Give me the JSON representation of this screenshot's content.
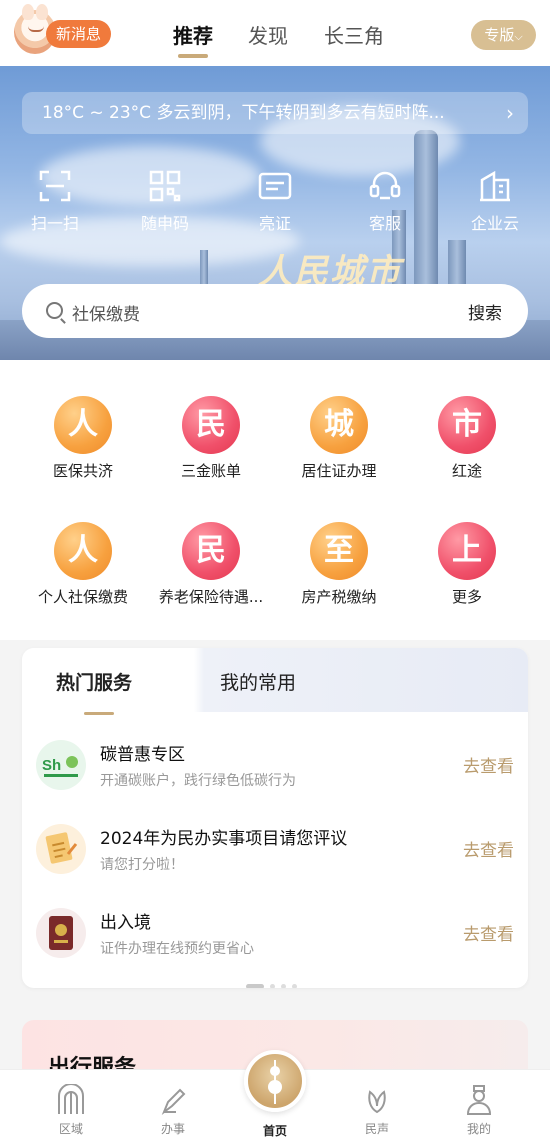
{
  "header": {
    "new_message": "新消息",
    "tabs": [
      "推荐",
      "发现",
      "长三角"
    ],
    "edition": "专版"
  },
  "banner": {
    "weather": "18°C ~ 23°C  多云到阴，下午转阴到多云有短时阵...",
    "quick_actions": [
      {
        "label": "扫一扫",
        "icon": "scan-icon"
      },
      {
        "label": "随申码",
        "icon": "qrcode-icon"
      },
      {
        "label": "亮证",
        "icon": "id-card-icon"
      },
      {
        "label": "客服",
        "icon": "headset-icon"
      },
      {
        "label": "企业云",
        "icon": "building-icon"
      }
    ],
    "slogan": "人民城市",
    "search_placeholder": "社保缴费",
    "search_button": "搜索"
  },
  "services": [
    {
      "char": "人",
      "label": "医保共济",
      "color": "orange"
    },
    {
      "char": "民",
      "label": "三金账单",
      "color": "red"
    },
    {
      "char": "城",
      "label": "居住证办理",
      "color": "orange"
    },
    {
      "char": "市",
      "label": "红途",
      "color": "red"
    },
    {
      "char": "人",
      "label": "个人社保缴费",
      "color": "orange"
    },
    {
      "char": "民",
      "label": "养老保险待遇...",
      "color": "red"
    },
    {
      "char": "至",
      "label": "房产税缴纳",
      "color": "orange"
    },
    {
      "char": "上",
      "label": "更多",
      "color": "red"
    }
  ],
  "hot_card": {
    "tabs": [
      "热门服务",
      "我的常用"
    ],
    "rows": [
      {
        "title": "碳普惠专区",
        "subtitle": "开通碳账户，践行绿色低碳行为",
        "action": "去查看"
      },
      {
        "title": "2024年为民办实事项目请您评议",
        "subtitle": "请您打分啦！",
        "action": "去查看"
      },
      {
        "title": "出入境",
        "subtitle": "证件办理在线预约更省心",
        "action": "去查看"
      }
    ]
  },
  "travel": {
    "title": "出行服务"
  },
  "bottom_nav": [
    "区域",
    "办事",
    "首页",
    "民声",
    "我的"
  ]
}
